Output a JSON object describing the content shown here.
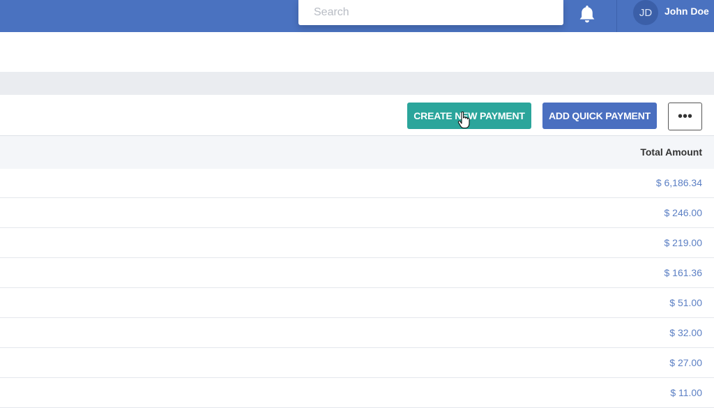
{
  "header": {
    "search_placeholder": "Search",
    "user": {
      "initials": "JD",
      "name": "John Doe"
    }
  },
  "toolbar": {
    "create_new_payment_label": "CREATE NEW PAYMENT",
    "add_quick_payment_label": "ADD QUICK PAYMENT",
    "more_label": "•••"
  },
  "table": {
    "columns": [
      "Total Amount"
    ],
    "rows": [
      {
        "total_amount": "$ 6,186.34"
      },
      {
        "total_amount": "$ 246.00"
      },
      {
        "total_amount": "$ 219.00"
      },
      {
        "total_amount": "$ 161.36"
      },
      {
        "total_amount": "$ 51.00"
      },
      {
        "total_amount": "$ 32.00"
      },
      {
        "total_amount": "$ 27.00"
      },
      {
        "total_amount": "$ 11.00"
      }
    ]
  },
  "colors": {
    "topbar": "#4a72c0",
    "create_button": "#2ba59b",
    "quick_button": "#4a6fc0",
    "amount_text": "#5b7fc4"
  },
  "icons": [
    "bell-icon",
    "more-options-icon",
    "pointer-cursor-icon"
  ]
}
